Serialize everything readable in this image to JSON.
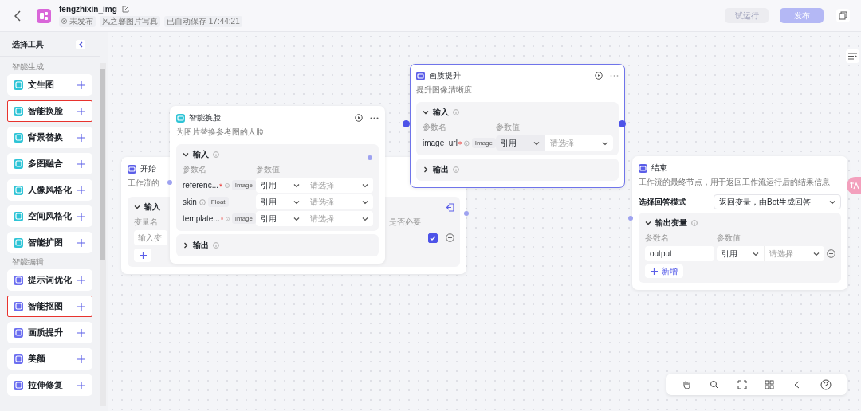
{
  "header": {
    "title": "fengzhixin_img",
    "status": "未发布",
    "space": "风之馨图片写真",
    "saved": "已自动保存 17:44:21",
    "buttons": [
      {
        "label": "试运行",
        "kind": "secondary",
        "disabled": true
      },
      {
        "label": "发布",
        "kind": "primary",
        "disabled": true
      }
    ]
  },
  "sidebar": {
    "title": "选择工具",
    "groups": [
      {
        "label": "智能生成",
        "items": [
          {
            "label": "文生图",
            "color": "#2ec4d6",
            "highlighted": false
          },
          {
            "label": "智能换脸",
            "color": "#2ec4d6",
            "highlighted": true
          },
          {
            "label": "背景替换",
            "color": "#2ec4d6",
            "highlighted": false
          },
          {
            "label": "多图融合",
            "color": "#2ec4d6",
            "highlighted": false
          },
          {
            "label": "人像风格化",
            "color": "#2ec4d6",
            "highlighted": false
          },
          {
            "label": "空间风格化",
            "color": "#2ec4d6",
            "highlighted": false
          },
          {
            "label": "智能扩图",
            "color": "#2ec4d6",
            "highlighted": false
          }
        ]
      },
      {
        "label": "智能编辑",
        "items": [
          {
            "label": "提示词优化",
            "color": "#6b6ef0",
            "highlighted": false
          },
          {
            "label": "智能抠图",
            "color": "#6b6ef0",
            "highlighted": true
          },
          {
            "label": "画质提升",
            "color": "#6b6ef0",
            "highlighted": false
          },
          {
            "label": "美颜",
            "color": "#6b6ef0",
            "highlighted": false
          },
          {
            "label": "拉伸修复",
            "color": "#6b6ef0",
            "highlighted": false
          }
        ]
      }
    ]
  },
  "nodes": [
    {
      "kind": "start",
      "title": "开始",
      "description": "工作流的",
      "input_label": "输入",
      "name_header": "变量名",
      "required_header": "是否必要",
      "placeholder": "输入变",
      "required": true
    },
    {
      "kind": "tool",
      "title": "智能换脸",
      "selected": false,
      "description": "为图片替换参考图的人脸",
      "input_label": "输入",
      "name_header": "参数名",
      "value_header": "参数值",
      "output_label": "输出",
      "rows": [
        {
          "name": "referenc...",
          "required": true,
          "type": "Image",
          "source": "引用",
          "placeholder": "请选择"
        },
        {
          "name": "skin",
          "required": false,
          "type": "Float",
          "source": "引用",
          "placeholder": "请选择"
        },
        {
          "name": "template...",
          "required": true,
          "type": "Image",
          "source": "引用",
          "placeholder": "请选择"
        }
      ]
    },
    {
      "kind": "tool",
      "title": "画质提升",
      "selected": true,
      "description": "提升图像清晰度",
      "input_label": "输入",
      "name_header": "参数名",
      "value_header": "参数值",
      "output_label": "输出",
      "rows": [
        {
          "name": "image_url",
          "required": true,
          "type": "Image",
          "source": "引用",
          "placeholder": "请选择"
        }
      ]
    },
    {
      "kind": "end",
      "title": "结束",
      "description": "工作流的最终节点，用于返回工作流运行后的结果信息",
      "mode_label": "选择回答模式",
      "mode_value": "返回变量，由Bot生成回答",
      "output_label": "输出变量",
      "name_header": "参数名",
      "value_header": "参数值",
      "rows": [
        {
          "name": "output",
          "source": "引用",
          "placeholder": "请选择"
        }
      ],
      "add_label": "新增"
    }
  ]
}
